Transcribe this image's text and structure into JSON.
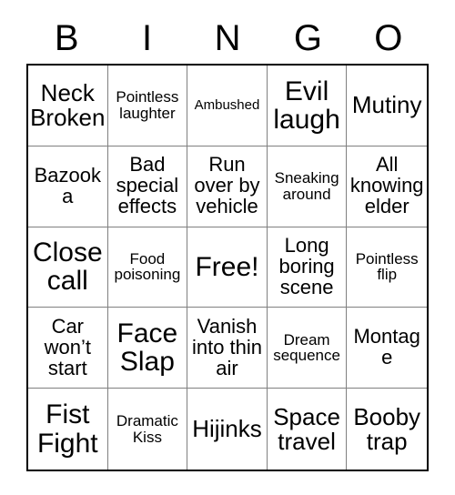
{
  "header": {
    "letters": [
      "B",
      "I",
      "N",
      "G",
      "O"
    ]
  },
  "grid": {
    "rows": 5,
    "columns": 5,
    "border_color": "#000000",
    "gridline_color": "#808080",
    "background_color": "#ffffff",
    "text_color": "#000000",
    "cells": [
      {
        "text": "Neck Broken",
        "size": "lg"
      },
      {
        "text": "Pointless laughter",
        "size": "sm"
      },
      {
        "text": "Ambushed",
        "size": "xs"
      },
      {
        "text": "Evil laugh",
        "size": "xl"
      },
      {
        "text": "Mutiny",
        "size": "lg"
      },
      {
        "text": "Bazooka",
        "size": "md"
      },
      {
        "text": "Bad special effects",
        "size": "md"
      },
      {
        "text": "Run over by vehicle",
        "size": "md"
      },
      {
        "text": "Sneaking around",
        "size": "sm"
      },
      {
        "text": "All knowing elder",
        "size": "md"
      },
      {
        "text": "Close call",
        "size": "xl"
      },
      {
        "text": "Food poisoning",
        "size": "sm"
      },
      {
        "text": "Free!",
        "size": "xl"
      },
      {
        "text": "Long boring scene",
        "size": "md"
      },
      {
        "text": "Pointless flip",
        "size": "sm"
      },
      {
        "text": "Car won’t start",
        "size": "md"
      },
      {
        "text": "Face Slap",
        "size": "xl"
      },
      {
        "text": "Vanish into thin air",
        "size": "md"
      },
      {
        "text": "Dream sequence",
        "size": "sm"
      },
      {
        "text": "Montage",
        "size": "md"
      },
      {
        "text": "Fist Fight",
        "size": "xl"
      },
      {
        "text": "Dramatic Kiss",
        "size": "sm"
      },
      {
        "text": "Hijinks",
        "size": "lg"
      },
      {
        "text": "Space travel",
        "size": "lg"
      },
      {
        "text": "Booby trap",
        "size": "lg"
      }
    ]
  }
}
